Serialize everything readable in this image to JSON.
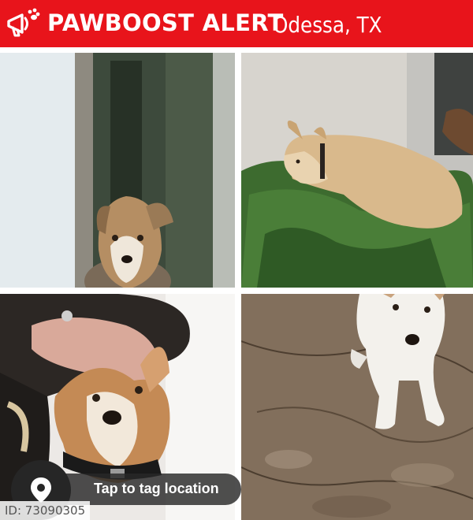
{
  "header": {
    "brand": "PAWBOOST ALERT",
    "location": "Odessa, TX",
    "logo_icon": "megaphone-paw-icon",
    "bg_color": "#e8141b"
  },
  "photos": [
    {
      "subject": "dog-behind-window"
    },
    {
      "subject": "dog-sleeping-on-green-blanket"
    },
    {
      "subject": "dog-with-owner"
    },
    {
      "subject": "white-dog-on-dirt"
    }
  ],
  "tag_location": {
    "label": "Tap to tag location",
    "icon": "map-pin-icon"
  },
  "id_badge": {
    "text": "ID: 73090305"
  }
}
